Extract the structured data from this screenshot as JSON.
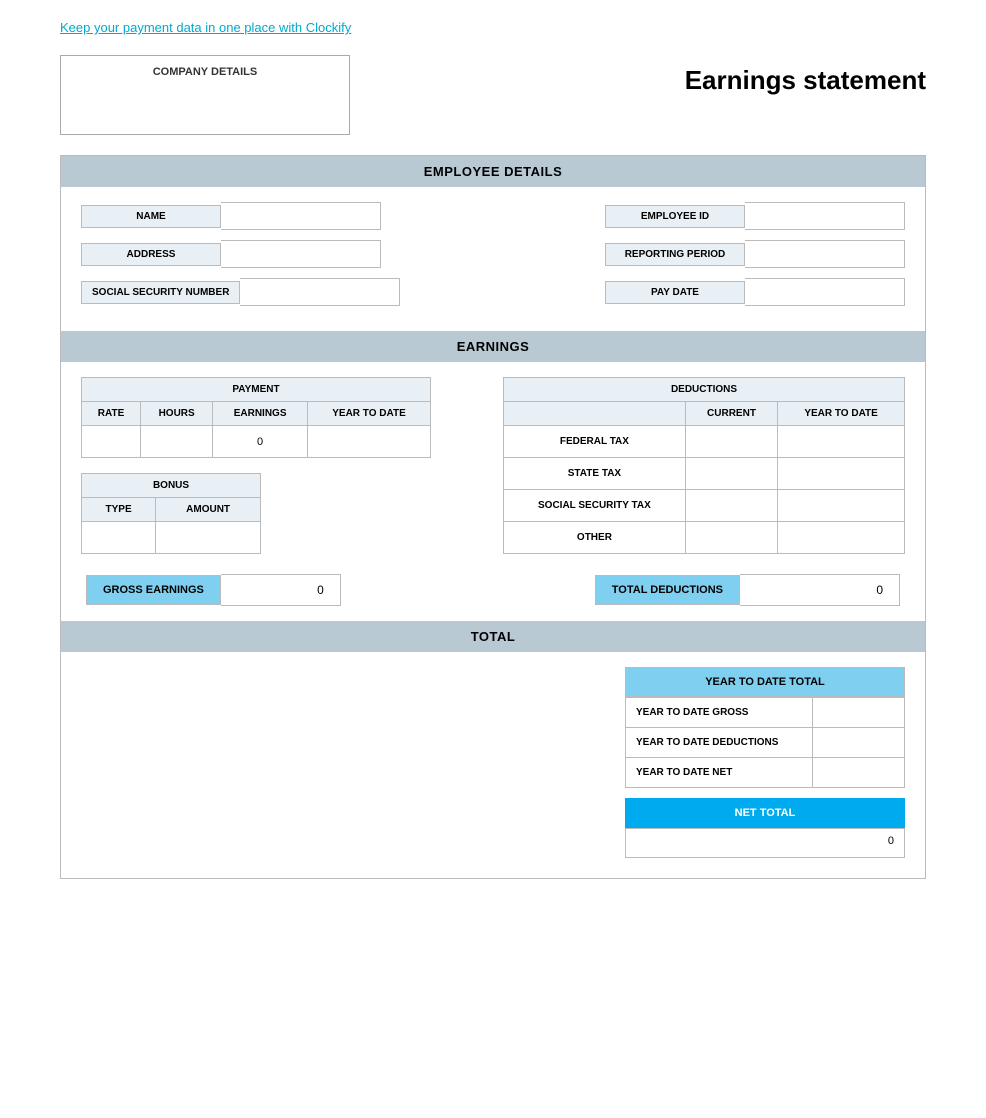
{
  "topLink": {
    "text": "Keep your payment data in one place with Clockify",
    "href": "#"
  },
  "header": {
    "companyLabel": "COMPANY DETAILS",
    "pageTitle": "Earnings statement"
  },
  "employeeDetails": {
    "sectionLabel": "EMPLOYEE DETAILS",
    "fields": {
      "nameLabel": "NAME",
      "nameValue": "",
      "addressLabel": "ADDRESS",
      "addressValue": "",
      "ssnLabel": "SOCIAL SECURITY NUMBER",
      "ssnValue": "",
      "employeeIdLabel": "EMPLOYEE ID",
      "employeeIdValue": "",
      "reportingPeriodLabel": "REPORTING PERIOD",
      "reportingPeriodValue": "",
      "payDateLabel": "PAY DATE",
      "payDateValue": ""
    }
  },
  "earnings": {
    "sectionLabel": "EARNINGS",
    "payment": {
      "tableLabel": "PAYMENT",
      "columns": [
        "RATE",
        "HOURS",
        "EARNINGS",
        "YEAR TO DATE"
      ],
      "rows": [
        {
          "rate": "",
          "hours": "",
          "earnings": "0",
          "yearToDate": ""
        }
      ]
    },
    "deductions": {
      "tableLabel": "DEDUCTIONS",
      "columns": [
        "CURRENT",
        "YEAR TO DATE"
      ],
      "rows": [
        {
          "label": "FEDERAL TAX",
          "current": "",
          "yearToDate": ""
        },
        {
          "label": "STATE TAX",
          "current": "",
          "yearToDate": ""
        },
        {
          "label": "SOCIAL SECURITY TAX",
          "current": "",
          "yearToDate": ""
        },
        {
          "label": "OTHER",
          "current": "",
          "yearToDate": ""
        }
      ]
    },
    "bonus": {
      "tableLabel": "BONUS",
      "columns": [
        "TYPE",
        "AMOUNT"
      ],
      "rows": [
        {
          "type": "",
          "amount": ""
        }
      ]
    },
    "grossEarnings": {
      "label": "GROSS EARNINGS",
      "value": "0"
    },
    "totalDeductions": {
      "label": "TOTAL DEDUCTIONS",
      "value": "0"
    }
  },
  "total": {
    "sectionLabel": "TOTAL",
    "ytd": {
      "header": "YEAR TO DATE TOTAL",
      "rows": [
        {
          "label": "YEAR TO DATE GROSS",
          "value": ""
        },
        {
          "label": "YEAR TO DATE DEDUCTIONS",
          "value": ""
        },
        {
          "label": "YEAR TO DATE NET",
          "value": ""
        }
      ]
    },
    "netTotal": {
      "label": "NET TOTAL",
      "value": "0"
    }
  }
}
